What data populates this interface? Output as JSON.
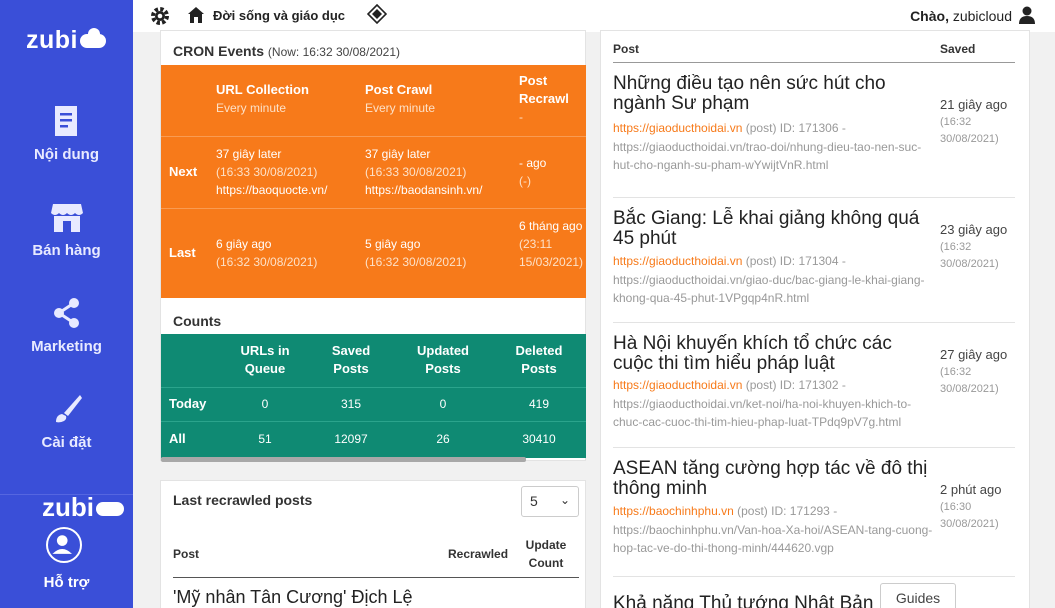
{
  "sidebar": {
    "logo": "zubi",
    "items": [
      {
        "label": "Nội dung",
        "icon": "document-icon"
      },
      {
        "label": "Bán hàng",
        "icon": "store-icon"
      },
      {
        "label": "Marketing",
        "icon": "share-icon"
      },
      {
        "label": "Cài đặt",
        "icon": "brush-icon"
      }
    ],
    "logo_bottom": "zubi",
    "support_label": "Hỗ trợ"
  },
  "topbar": {
    "site_name": "Đời sống và giáo dục",
    "greeting_prefix": "Chào,",
    "username": "zubicloud"
  },
  "cron": {
    "title": "CRON Events",
    "now": "(Now: 16:32 30/08/2021)",
    "columns": [
      {
        "title": "URL Collection",
        "sub": "Every minute"
      },
      {
        "title": "Post Crawl",
        "sub": "Every minute"
      },
      {
        "title": "Post Recrawl",
        "sub": "-"
      }
    ],
    "next": {
      "label": "Next",
      "c1": [
        "37 giây later",
        "(16:33 30/08/2021)",
        "https://baoquocte.vn/"
      ],
      "c2": [
        "37 giây later",
        "(16:33 30/08/2021)",
        "https://baodansinh.vn/"
      ],
      "c3": [
        "- ago",
        "(-)"
      ]
    },
    "last": {
      "label": "Last",
      "c1": [
        "6 giây ago",
        "(16:32 30/08/2021)"
      ],
      "c2": [
        "5 giây ago",
        "(16:32 30/08/2021)"
      ],
      "c3": [
        "6 tháng ago",
        "(23:11 15/03/2021)"
      ]
    }
  },
  "counts": {
    "title": "Counts",
    "headers": [
      "URLs in Queue",
      "Saved Posts",
      "Updated Posts",
      "Deleted Posts"
    ],
    "rows": [
      {
        "label": "Today",
        "values": [
          "0",
          "315",
          "0",
          "419"
        ]
      },
      {
        "label": "All",
        "values": [
          "51",
          "12097",
          "26",
          "30410"
        ]
      }
    ]
  },
  "recrawl": {
    "title": "Last recrawled posts",
    "select_value": "5",
    "headers": {
      "post": "Post",
      "recrawled": "Recrawled",
      "update_count": "Update Count"
    },
    "first_title": "'Mỹ nhân Tân Cương' Địch Lệ"
  },
  "posts": {
    "headers": {
      "post": "Post",
      "saved": "Saved"
    },
    "items": [
      {
        "title": "Những điều tạo nên sức hút cho ngành Sư phạm",
        "source": "https://giaoducthoidai.vn",
        "type": "(post)",
        "id": "ID: 171306",
        "url": "https://giaoducthoidai.vn/trao-doi/nhung-dieu-tao-nen-suc-hut-cho-nganh-su-pham-wYwijtVnR.html",
        "saved": "21 giây ago",
        "saved_date": "(16:32 30/08/2021)"
      },
      {
        "title": "Bắc Giang: Lễ khai giảng không quá 45 phút",
        "source": "https://giaoducthoidai.vn",
        "type": "(post)",
        "id": "ID: 171304",
        "url": "https://giaoducthoidai.vn/giao-duc/bac-giang-le-khai-giang-khong-qua-45-phut-1VPgqp4nR.html",
        "saved": "23 giây ago",
        "saved_date": "(16:32 30/08/2021)"
      },
      {
        "title": "Hà Nội khuyến khích tổ chức các cuộc thi tìm hiểu pháp luật",
        "source": "https://giaoducthoidai.vn",
        "type": "(post)",
        "id": "ID: 171302",
        "url": "https://giaoducthoidai.vn/ket-noi/ha-noi-khuyen-khich-to-chuc-cac-cuoc-thi-tim-hieu-phap-luat-TPdq9pV7g.html",
        "saved": "27 giây ago",
        "saved_date": "(16:32 30/08/2021)"
      },
      {
        "title": "ASEAN tăng cường hợp tác về đô thị thông minh",
        "source": "https://baochinhphu.vn",
        "type": "(post)",
        "id": "ID: 171293",
        "url": "https://baochinhphu.vn/Van-hoa-Xa-hoi/ASEAN-tang-cuong-hop-tac-ve-do-thi-thong-minh/444620.vgp",
        "saved": "2 phút ago",
        "saved_date": "(16:30 30/08/2021)"
      }
    ],
    "last_title": "Khả năng Thủ tướng Nhật Bản"
  },
  "guides_label": "Guides"
}
